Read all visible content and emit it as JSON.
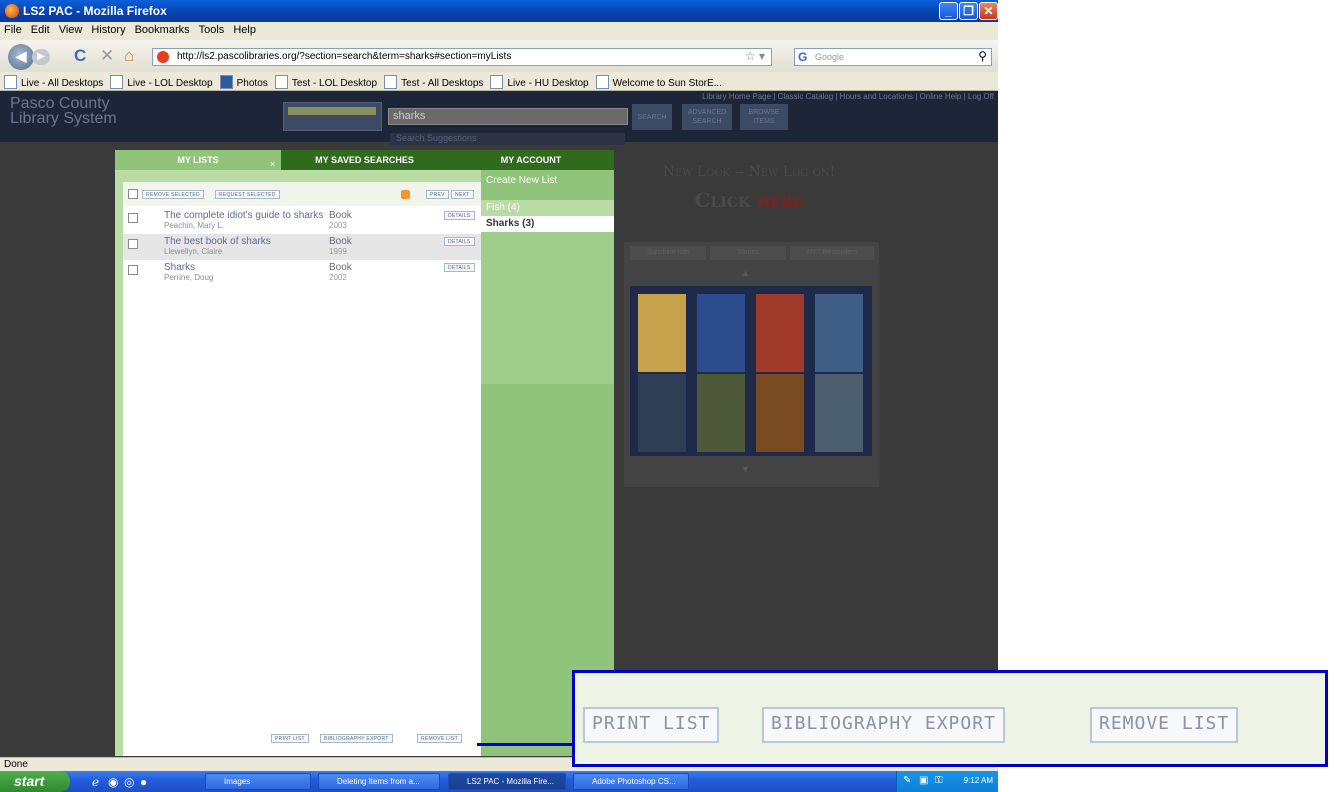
{
  "window": {
    "title": "LS2 PAC - Mozilla Firefox",
    "minimize_icon": "minimize-icon",
    "maximize_icon": "maximize-icon",
    "close_icon": "close-icon"
  },
  "menu": [
    "File",
    "Edit",
    "View",
    "History",
    "Bookmarks",
    "Tools",
    "Help"
  ],
  "nav": {
    "url": "http://ls2.pascolibraries.org/?section=search&term=sharks#section=myLists",
    "search_placeholder": "Google",
    "search_engine_label": "G"
  },
  "bookmarks": [
    "Live - All Desktops",
    "Live - LOL Desktop",
    "Photos",
    "Test - LOL Desktop",
    "Test - All Desktops",
    "Live - HU Desktop",
    "Welcome to Sun StorE..."
  ],
  "library": {
    "logo": "Pasco County Library System",
    "search_value": "sharks",
    "search_btn": "SEARCH",
    "advanced_btn": "ADVANCED SEARCH",
    "browse_btn": "BROWSE ITEMS",
    "suggestions": "Search Suggestions",
    "links": "Library Home Page | Classic Catalog | Hours and Locations | Online Help | Log Off"
  },
  "tabs": {
    "my_lists": "MY LISTS",
    "saved_searches": "MY SAVED SEARCHES",
    "my_account": "MY ACCOUNT",
    "close": "×"
  },
  "toolbar": {
    "remove_selected": "REMOVE SELECTED",
    "request_selected": "REQUEST SELECTED",
    "prev": "PREV",
    "next": "NEXT"
  },
  "items": [
    {
      "title": "The complete idiot's guide to sharks",
      "author": "Peachin, Mary L.",
      "format": "Book",
      "year": "2003",
      "details": "DETAILS"
    },
    {
      "title": "The best book of sharks",
      "author": "Llewellyn, Claire",
      "format": "Book",
      "year": "1999",
      "details": "DETAILS"
    },
    {
      "title": "Sharks",
      "author": "Perrine, Doug",
      "format": "Book",
      "year": "2002",
      "details": "DETAILS"
    }
  ],
  "bottom_buttons": {
    "print": "PRINT LIST",
    "export": "BIBLIOGRAPHY EXPORT",
    "remove": "REMOVE LIST"
  },
  "sidebar": {
    "create": "Create New List",
    "lists": [
      "Fish (4)",
      "Sharks (3)"
    ]
  },
  "promo": {
    "line1": "New Look -- New Log on!",
    "line2_a": "Click",
    "line2_b": "here",
    "tabs": [
      "Sunshine Kits",
      "Stories",
      "NYT Bestsellers"
    ]
  },
  "status": "Done",
  "taskbar": {
    "start": "start",
    "tasks": [
      "Images",
      "Deleting Items from a...",
      "LS2 PAC - Mozilla Fire...",
      "Adobe Photoshop CS..."
    ],
    "clock": "9:12 AM"
  },
  "zoom_buttons": {
    "print": "PRINT LIST",
    "export": "BIBLIOGRAPHY EXPORT",
    "remove": "REMOVE LIST"
  },
  "colors": {
    "accent_green": "#2f6a1d",
    "light_green": "#8fc47a",
    "callout_border": "#0000cc"
  }
}
